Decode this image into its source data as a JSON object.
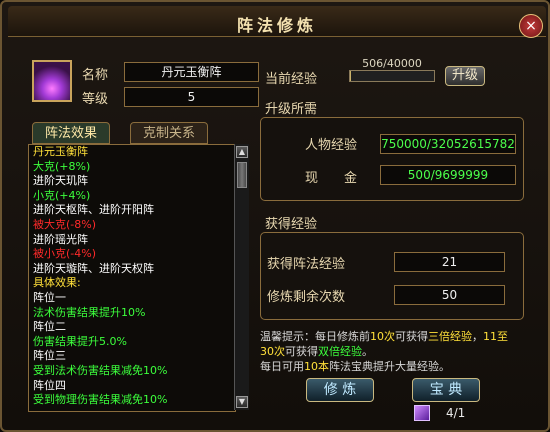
{
  "window": {
    "title": "阵法修炼",
    "close_label": "×"
  },
  "info": {
    "name_label": "名称",
    "name_value": "丹元玉衡阵",
    "level_label": "等级",
    "level_value": "5",
    "exp_label": "当前经验",
    "exp_text": "506/40000",
    "exp_current": 506,
    "exp_max": 40000,
    "upgrade_label": "升级"
  },
  "upgrade_req": {
    "title": "升级所需",
    "char_exp_label": "人物经验",
    "char_exp_value": "750000/32052615782",
    "cash_label": "现　　金",
    "cash_value": "500/9699999"
  },
  "gain": {
    "title": "获得经验",
    "formation_exp_label": "获得阵法经验",
    "formation_exp_value": "21",
    "remaining_label": "修炼剩余次数",
    "remaining_value": "50"
  },
  "tabs": [
    {
      "label": "阵法效果",
      "active": true
    },
    {
      "label": "克制关系",
      "active": false
    }
  ],
  "effects": [
    {
      "text": "丹元玉衡阵",
      "color": "#ffe03a"
    },
    {
      "text": "大克(+8%)",
      "color": "#3cff3c"
    },
    {
      "text": "进阶天玑阵",
      "color": "#ffffff"
    },
    {
      "text": "小克(+4%)",
      "color": "#3cff3c"
    },
    {
      "text": "进阶天枢阵、进阶开阳阵",
      "color": "#ffffff"
    },
    {
      "text": "被大克(-8%)",
      "color": "#ff2a2a"
    },
    {
      "text": "进阶瑶光阵",
      "color": "#ffffff"
    },
    {
      "text": "被小克(-4%)",
      "color": "#ff2a2a"
    },
    {
      "text": "进阶天璇阵、进阶天权阵",
      "color": "#ffffff"
    },
    {
      "text": "具体效果:",
      "color": "#ffe03a"
    },
    {
      "text": "阵位一",
      "color": "#ffffff"
    },
    {
      "text": "法术伤害结果提升10%",
      "color": "#3cff3c"
    },
    {
      "text": "阵位二",
      "color": "#ffffff"
    },
    {
      "text": "伤害结果提升5.0%",
      "color": "#3cff3c"
    },
    {
      "text": "阵位三",
      "color": "#ffffff"
    },
    {
      "text": "受到法术伤害结果减免10%",
      "color": "#3cff3c"
    },
    {
      "text": "阵位四",
      "color": "#ffffff"
    },
    {
      "text": "受到物理伤害结果减免10%",
      "color": "#3cff3c"
    }
  ],
  "tip": {
    "p1": "温馨提示：每日修炼前",
    "p2": "10次",
    "p3": "可获得",
    "p4": "三倍经验",
    "p5": "，",
    "p6": "11至",
    "p7": "30次",
    "p8": "可获得",
    "p9": "双倍经验",
    "p10": "。",
    "p11": "每日可用",
    "p12": "10本",
    "p13": "阵法宝典提升大量经验。"
  },
  "buttons": {
    "train_label": "修 炼",
    "treasure_label": "宝 典"
  },
  "book": {
    "count": "4/1"
  }
}
